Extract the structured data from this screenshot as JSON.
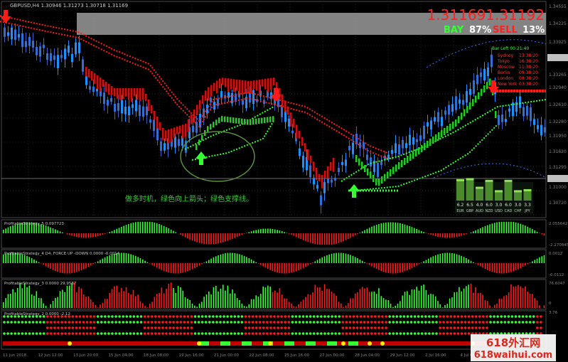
{
  "header": {
    "symbol_ohlc": "GBPUSD,H4  1.30946 1.31273 1.30718 1.31169",
    "big_price": "1.311691.31192",
    "bay_label": "BAY",
    "bay_pct": "87%",
    "sell_label": "SELL",
    "sell_pct": "13%"
  },
  "price_axis": [
    "1.34555",
    "1.34225",
    "1.33925",
    "1.33595",
    "1.33265",
    "1.32940",
    "1.32610",
    "1.32280",
    "1.31950",
    "1.31620",
    "1.31295",
    "1.31169",
    "1.31000",
    "1.30720"
  ],
  "session_panel": {
    "bar_left": "Bar Left  00:21:40",
    "rows": [
      {
        "city": "Sydney",
        "time": "13:38:20"
      },
      {
        "city": "Tokyo",
        "time": "16:38:20"
      },
      {
        "city": "Moscow",
        "time": "11:38:20"
      },
      {
        "city": "Berlin",
        "time": "09:38:20"
      },
      {
        "city": "London",
        "time": "08:38:20"
      },
      {
        "city": "New York",
        "time": "03:38:20"
      }
    ]
  },
  "annotation": "做多时机，绿色向上箭头；绿色支撑线。",
  "currency_strength": {
    "values": [
      6.2,
      6.5,
      4.0,
      6.0,
      3.0,
      6.0,
      3.0,
      3.3
    ],
    "labels": [
      "6.2",
      "6.5",
      "4.0",
      "6.0",
      "3.0",
      "6.0",
      "3.0",
      "3.3"
    ],
    "currencies": [
      "EUR",
      "GBP",
      "AUD",
      "NZD",
      "USD",
      "CAD",
      "CHF",
      "JPY"
    ]
  },
  "subwindows": [
    {
      "title": "ProfitableStrategy_5  0.097723",
      "scale_top": "2.055642",
      "scale_bottom": "-2.270845"
    },
    {
      "title": "ProfitableStrategy_4  D4, FORCE UP -DOWN  0.0000 -0.0014",
      "scale_top": "0.0012",
      "scale_bottom": "-0.0112"
    },
    {
      "title": "ProfitableStrategy_3  0.0000 29.9587",
      "scale_top": "76.6047",
      "scale_bottom": "0"
    },
    {
      "title": "ProfitableStrategy_2  0.0000 -2.12",
      "scale_top": "3.76",
      "scale_bottom": ""
    }
  ],
  "time_axis": [
    "11 Jun 2018",
    "12 Jun 12:00",
    "13 Jun 20:00",
    "15 Jun 04:00",
    "18 Jun 08:00",
    "19 Jun 16:00",
    "21 Jun 00:00",
    "22 Jun 08:00",
    "25 Jun 16:00",
    "27 Jun 00:00",
    "28 Jun 04:00",
    "29 Jun 12:00",
    "2 Jul 16:00",
    "4 Jul 00:00",
    "5 Jul 08:00",
    "6 Jul 16:00"
  ],
  "watermark": {
    "line1": "618外汇网",
    "line2": "618waihui.com"
  },
  "colors": {
    "bull": "#1e90ff",
    "bear": "#ff1a1a",
    "green": "#33ff33",
    "grid": "#2a3a2a",
    "axis": "#808080"
  }
}
